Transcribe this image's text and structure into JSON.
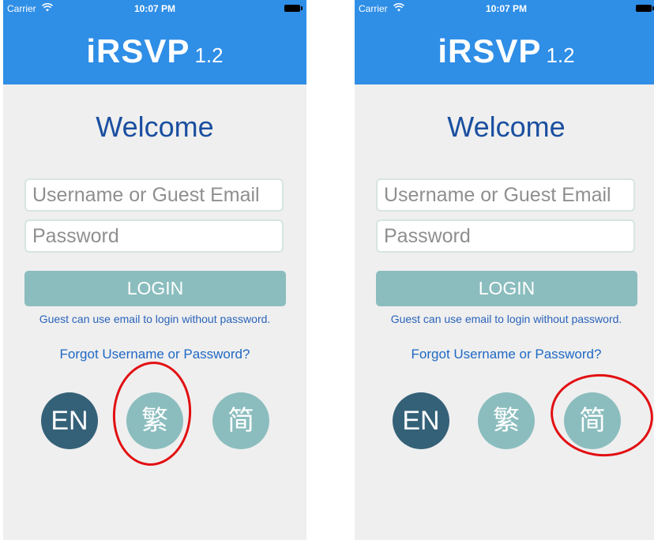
{
  "screens": [
    {
      "status": {
        "carrier": "Carrier",
        "time": "10:07 PM"
      },
      "app": {
        "name": "iRSVP",
        "version": "1.2"
      },
      "welcome": "Welcome",
      "username_placeholder": "Username or Guest Email",
      "password_placeholder": "Password",
      "login_label": "LOGIN",
      "hint": "Guest can use email to login without password.",
      "forgot": "Forgot Username or Password?",
      "languages": [
        "EN",
        "繁",
        "简"
      ],
      "highlighted_language": "繁"
    },
    {
      "status": {
        "carrier": "Carrier",
        "time": "10:07 PM"
      },
      "app": {
        "name": "iRSVP",
        "version": "1.2"
      },
      "welcome": "Welcome",
      "username_placeholder": "Username or Guest Email",
      "password_placeholder": "Password",
      "login_label": "LOGIN",
      "hint": "Guest can use email to login without password.",
      "forgot": "Forgot Username or Password?",
      "languages": [
        "EN",
        "繁",
        "简"
      ],
      "highlighted_language": "简"
    }
  ],
  "colors": {
    "header": "#2f8ee6",
    "background": "#efefef",
    "welcome_text": "#1a4fa0",
    "login_button": "#8bbdbe",
    "lang_en": "#346178",
    "lang_zh": "#8bbdbe",
    "highlight_circle": "#e20f12"
  }
}
